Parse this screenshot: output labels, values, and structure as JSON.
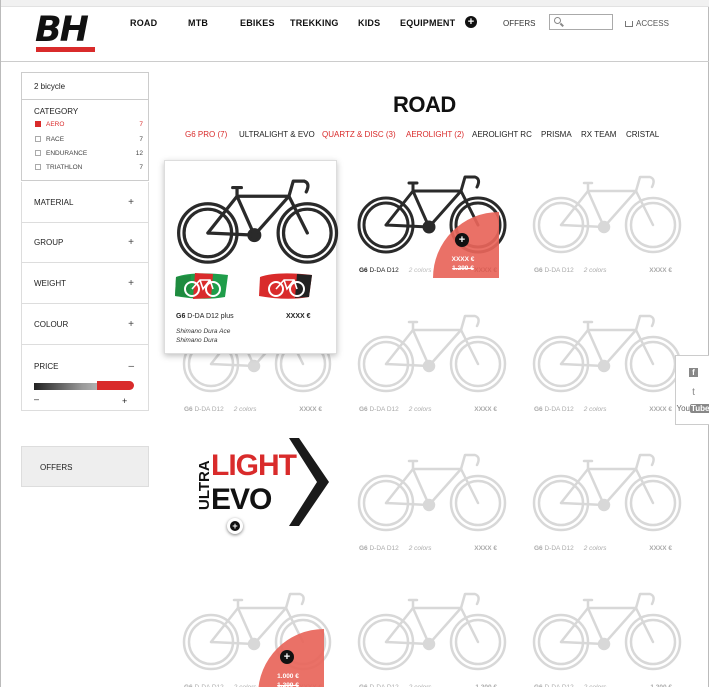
{
  "header": {
    "logo": "BH",
    "nav": [
      "ROAD",
      "MTB",
      "EBIKES",
      "TREKKING",
      "KIDS",
      "EQUIPMENT"
    ],
    "plus_icon": "+",
    "offers": "OFFERS",
    "search_placeholder": "",
    "access": "ACCESS"
  },
  "sidebar": {
    "count": "2 bicycle",
    "category_title": "CATEGORY",
    "categories": [
      {
        "label": "AERO",
        "count": "7",
        "active": true
      },
      {
        "label": "RACE",
        "count": "7",
        "active": false
      },
      {
        "label": "ENDURANCE",
        "count": "12",
        "active": false
      },
      {
        "label": "TRIATHLON",
        "count": "7",
        "active": false
      }
    ],
    "filters": [
      {
        "label": "MATERIAL",
        "sign": "+"
      },
      {
        "label": "GROUP",
        "sign": "+"
      },
      {
        "label": "WEIGHT",
        "sign": "+"
      },
      {
        "label": "COLOUR",
        "sign": "+"
      }
    ],
    "price": {
      "label": "PRICE",
      "sign": "–",
      "min_sign": "–",
      "max_sign": "+"
    },
    "offers": "OFFERS"
  },
  "main": {
    "title": "ROAD",
    "subnav": [
      {
        "label": "G6 PRO (7)",
        "red": true
      },
      {
        "label": "ULTRALIGHT & EVO",
        "red": false
      },
      {
        "label": "QUARTZ & DISC (3)",
        "red": true
      },
      {
        "label": "AEROLIGHT (2)",
        "red": true
      },
      {
        "label": "AEROLIGHT RC",
        "red": false
      },
      {
        "label": "PRISMA",
        "red": false
      },
      {
        "label": "RX TEAM",
        "red": false
      },
      {
        "label": "CRISTAL",
        "red": false
      }
    ],
    "featured": {
      "model": "G6",
      "name": "D-DA D12 plus",
      "price": "XXXX €",
      "groups": [
        "Shimano Dura Ace",
        "Shimano Dura"
      ]
    },
    "card": {
      "model": "G6",
      "name": "D-DA D12",
      "colors": "2 colors",
      "price": "XXXX €"
    },
    "card_price_alt": "1.200 €",
    "promo1": {
      "price": "XXXX €",
      "old": "1.299 €"
    },
    "promo2": {
      "price": "1.000 €",
      "old": "1.299 €"
    },
    "ultralight": {
      "ultra": "ULTRA",
      "light": "LIGHT",
      "evo": "EVO"
    }
  },
  "social": {
    "twitter": "t",
    "youtube_you": "You",
    "youtube_tube": "Tube",
    "facebook": "f"
  }
}
